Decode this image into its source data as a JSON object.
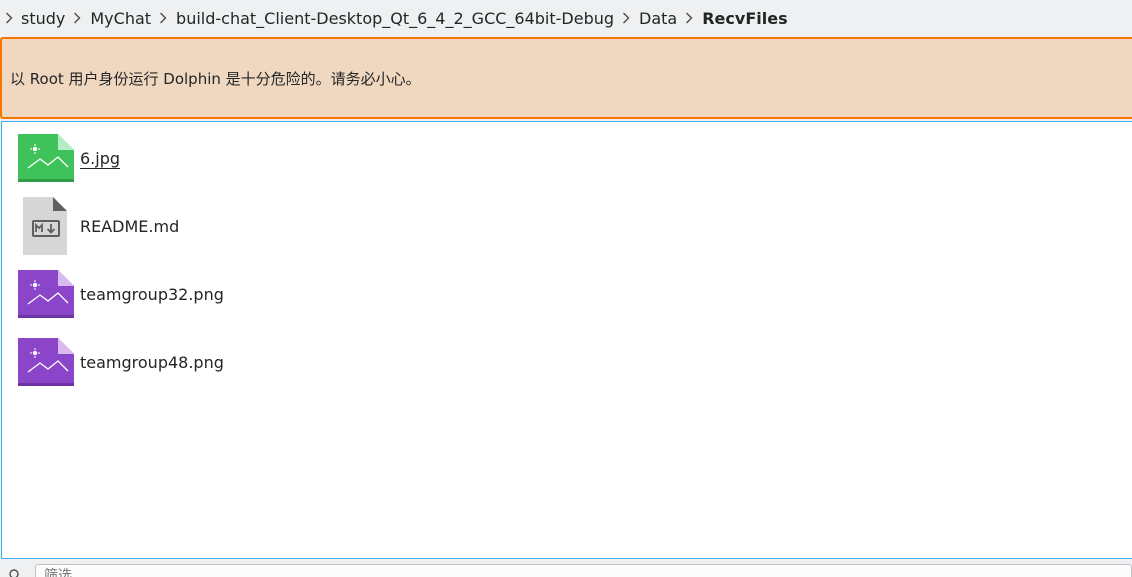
{
  "breadcrumb": {
    "items": [
      {
        "label": "study"
      },
      {
        "label": "MyChat"
      },
      {
        "label": "build-chat_Client-Desktop_Qt_6_4_2_GCC_64bit-Debug"
      },
      {
        "label": "Data"
      },
      {
        "label": "RecvFiles"
      }
    ]
  },
  "warning": {
    "text": "以 Root 用户身份运行 Dolphin 是十分危险的。请务必小心。",
    "accent_color": "#f67400",
    "background_color": "#f0d8c0"
  },
  "files": [
    {
      "name": "6.jpg",
      "icon": "jpg-image-icon",
      "color": "#3fc25a"
    },
    {
      "name": "README.md",
      "icon": "markdown-file-icon",
      "color": "#d3d3d3"
    },
    {
      "name": "teamgroup32.png",
      "icon": "png-image-icon",
      "color": "#8a45c8"
    },
    {
      "name": "teamgroup48.png",
      "icon": "png-image-icon",
      "color": "#8a45c8"
    }
  ],
  "filter": {
    "placeholder": "筛选",
    "icon": "filter-icon"
  },
  "colors": {
    "selection_border": "#3daee9"
  }
}
